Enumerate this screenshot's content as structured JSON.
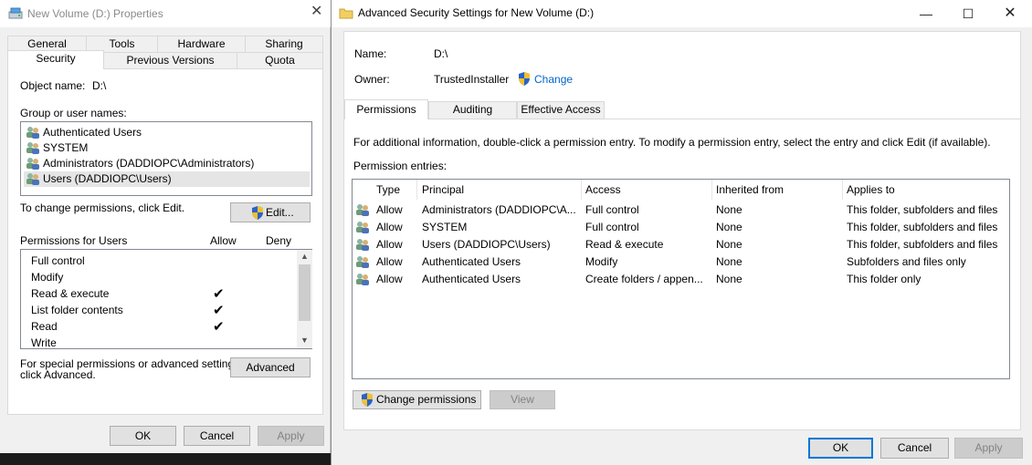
{
  "properties": {
    "title": "New Volume (D:) Properties",
    "tabs_row1": [
      "General",
      "Tools",
      "Hardware",
      "Sharing"
    ],
    "tabs_row2": [
      "Security",
      "Previous Versions",
      "Quota"
    ],
    "object_name_label": "Object name:",
    "object_name_value": "D:\\",
    "groups_label": "Group or user names:",
    "groups": [
      "Authenticated Users",
      "SYSTEM",
      "Administrators (DADDIOPC\\Administrators)",
      "Users (DADDIOPC\\Users)"
    ],
    "change_text": "To change permissions, click Edit.",
    "edit_label": "Edit...",
    "permissions_for": "Permissions for Users",
    "allow_label": "Allow",
    "deny_label": "Deny",
    "permissions": [
      {
        "name": "Full control",
        "allow": false,
        "deny": false
      },
      {
        "name": "Modify",
        "allow": false,
        "deny": false
      },
      {
        "name": "Read & execute",
        "allow": true,
        "deny": false
      },
      {
        "name": "List folder contents",
        "allow": true,
        "deny": false
      },
      {
        "name": "Read",
        "allow": true,
        "deny": false
      },
      {
        "name": "Write",
        "allow": false,
        "deny": false
      }
    ],
    "special_text_1": "For special permissions or advanced settings,",
    "special_text_2": "click Advanced.",
    "advanced_label": "Advanced",
    "ok_label": "OK",
    "cancel_label": "Cancel",
    "apply_label": "Apply"
  },
  "advanced": {
    "title": "Advanced Security Settings for New Volume (D:)",
    "name_label": "Name:",
    "name_value": "D:\\",
    "owner_label": "Owner:",
    "owner_value": "TrustedInstaller",
    "change_link": "Change",
    "tabs": [
      "Permissions",
      "Auditing",
      "Effective Access"
    ],
    "info_text": "For additional information, double-click a permission entry. To modify a permission entry, select the entry and click Edit (if available).",
    "entries_label": "Permission entries:",
    "columns": [
      "Type",
      "Principal",
      "Access",
      "Inherited from",
      "Applies to"
    ],
    "rows": [
      [
        "Allow",
        "Administrators (DADDIOPC\\A...",
        "Full control",
        "None",
        "This folder, subfolders and files"
      ],
      [
        "Allow",
        "SYSTEM",
        "Full control",
        "None",
        "This folder, subfolders and files"
      ],
      [
        "Allow",
        "Users (DADDIOPC\\Users)",
        "Read & execute",
        "None",
        "This folder, subfolders and files"
      ],
      [
        "Allow",
        "Authenticated Users",
        "Modify",
        "None",
        "Subfolders and files only"
      ],
      [
        "Allow",
        "Authenticated Users",
        "Create folders / appen...",
        "None",
        "This folder only"
      ]
    ],
    "change_permissions_label": "Change permissions",
    "view_label": "View",
    "ok_label": "OK",
    "cancel_label": "Cancel",
    "apply_label": "Apply"
  },
  "colors": {
    "accent": "#0078d7",
    "link": "#0066cc"
  }
}
